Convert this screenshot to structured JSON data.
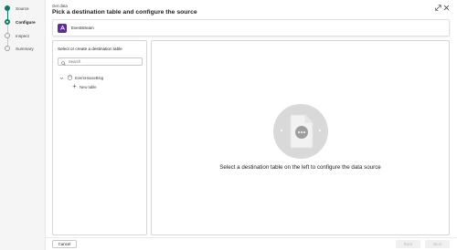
{
  "wizard": {
    "steps": [
      {
        "label": "Source",
        "state": "done"
      },
      {
        "label": "Configure",
        "state": "current"
      },
      {
        "label": "Inspect",
        "state": "pending"
      },
      {
        "label": "Summary",
        "state": "pending"
      }
    ]
  },
  "header": {
    "subtitle": "Get data",
    "title": "Pick a destination table and configure the source",
    "icons": [
      "expand-icon",
      "close-icon"
    ]
  },
  "source": {
    "name": "Eventstream",
    "icon": "eventstream-icon",
    "icon_color": "#5c2d91"
  },
  "destination": {
    "title": "Select or create a destination table",
    "search_placeholder": "Search",
    "database": "EventHouseBlog",
    "new_table_label": "New table"
  },
  "main": {
    "message": "Select a destination table on the left to configure the data source"
  },
  "footer": {
    "cancel_label": "Cancel",
    "back_label": "Back",
    "next_label": "Next"
  },
  "colors": {
    "accent": "#117865"
  }
}
